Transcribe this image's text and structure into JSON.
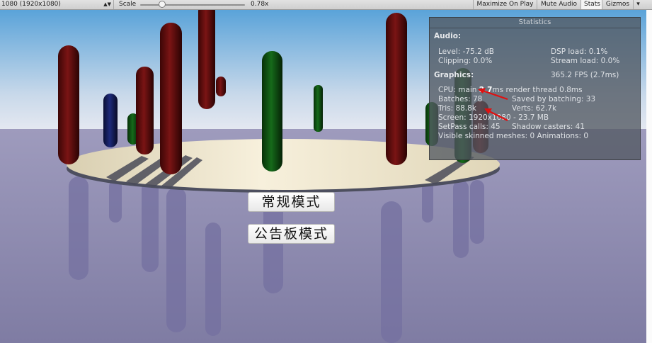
{
  "toolbar": {
    "resolution": "1080 (1920x1080)",
    "scale_label": "Scale",
    "scale_value": "0.78x",
    "scale_fraction": 0.18,
    "maximize": "Maximize On Play",
    "mute": "Mute Audio",
    "stats": "Stats",
    "gizmos": "Gizmos"
  },
  "buttons": {
    "normal_mode": "常规模式",
    "billboard_mode": "公告板模式"
  },
  "stats": {
    "title": "Statistics",
    "audio_header": "Audio:",
    "level": "Level: -75.2 dB",
    "dsp": "DSP load: 0.1%",
    "clipping": "Clipping: 0.0%",
    "stream": "Stream load: 0.0%",
    "graphics_header": "Graphics:",
    "fps": "365.2 FPS (2.7ms)",
    "cpu_label": "CPU: main ",
    "cpu_main": "2.7",
    "cpu_rest": "ms  render thread 0.8ms",
    "batches": "Batches: 78",
    "saved_batching": "Saved by batching: 33",
    "tris": "Tris: 88.8k",
    "verts": "Verts: 62.7k",
    "screen": "Screen: 1920x1080 - 23.7 MB",
    "setpass": "SetPass calls: 45",
    "shadow": "Shadow casters: 41",
    "skinned": "Visible skinned meshes: 0  Animations: 0"
  },
  "colors": {
    "red_pill": "#5a0c0c",
    "green_pill": "#0e4a10",
    "blue_pill": "#101a4a",
    "platform": "#efe6cc",
    "ground": "#8a87ad",
    "arrow": "#e01010"
  }
}
